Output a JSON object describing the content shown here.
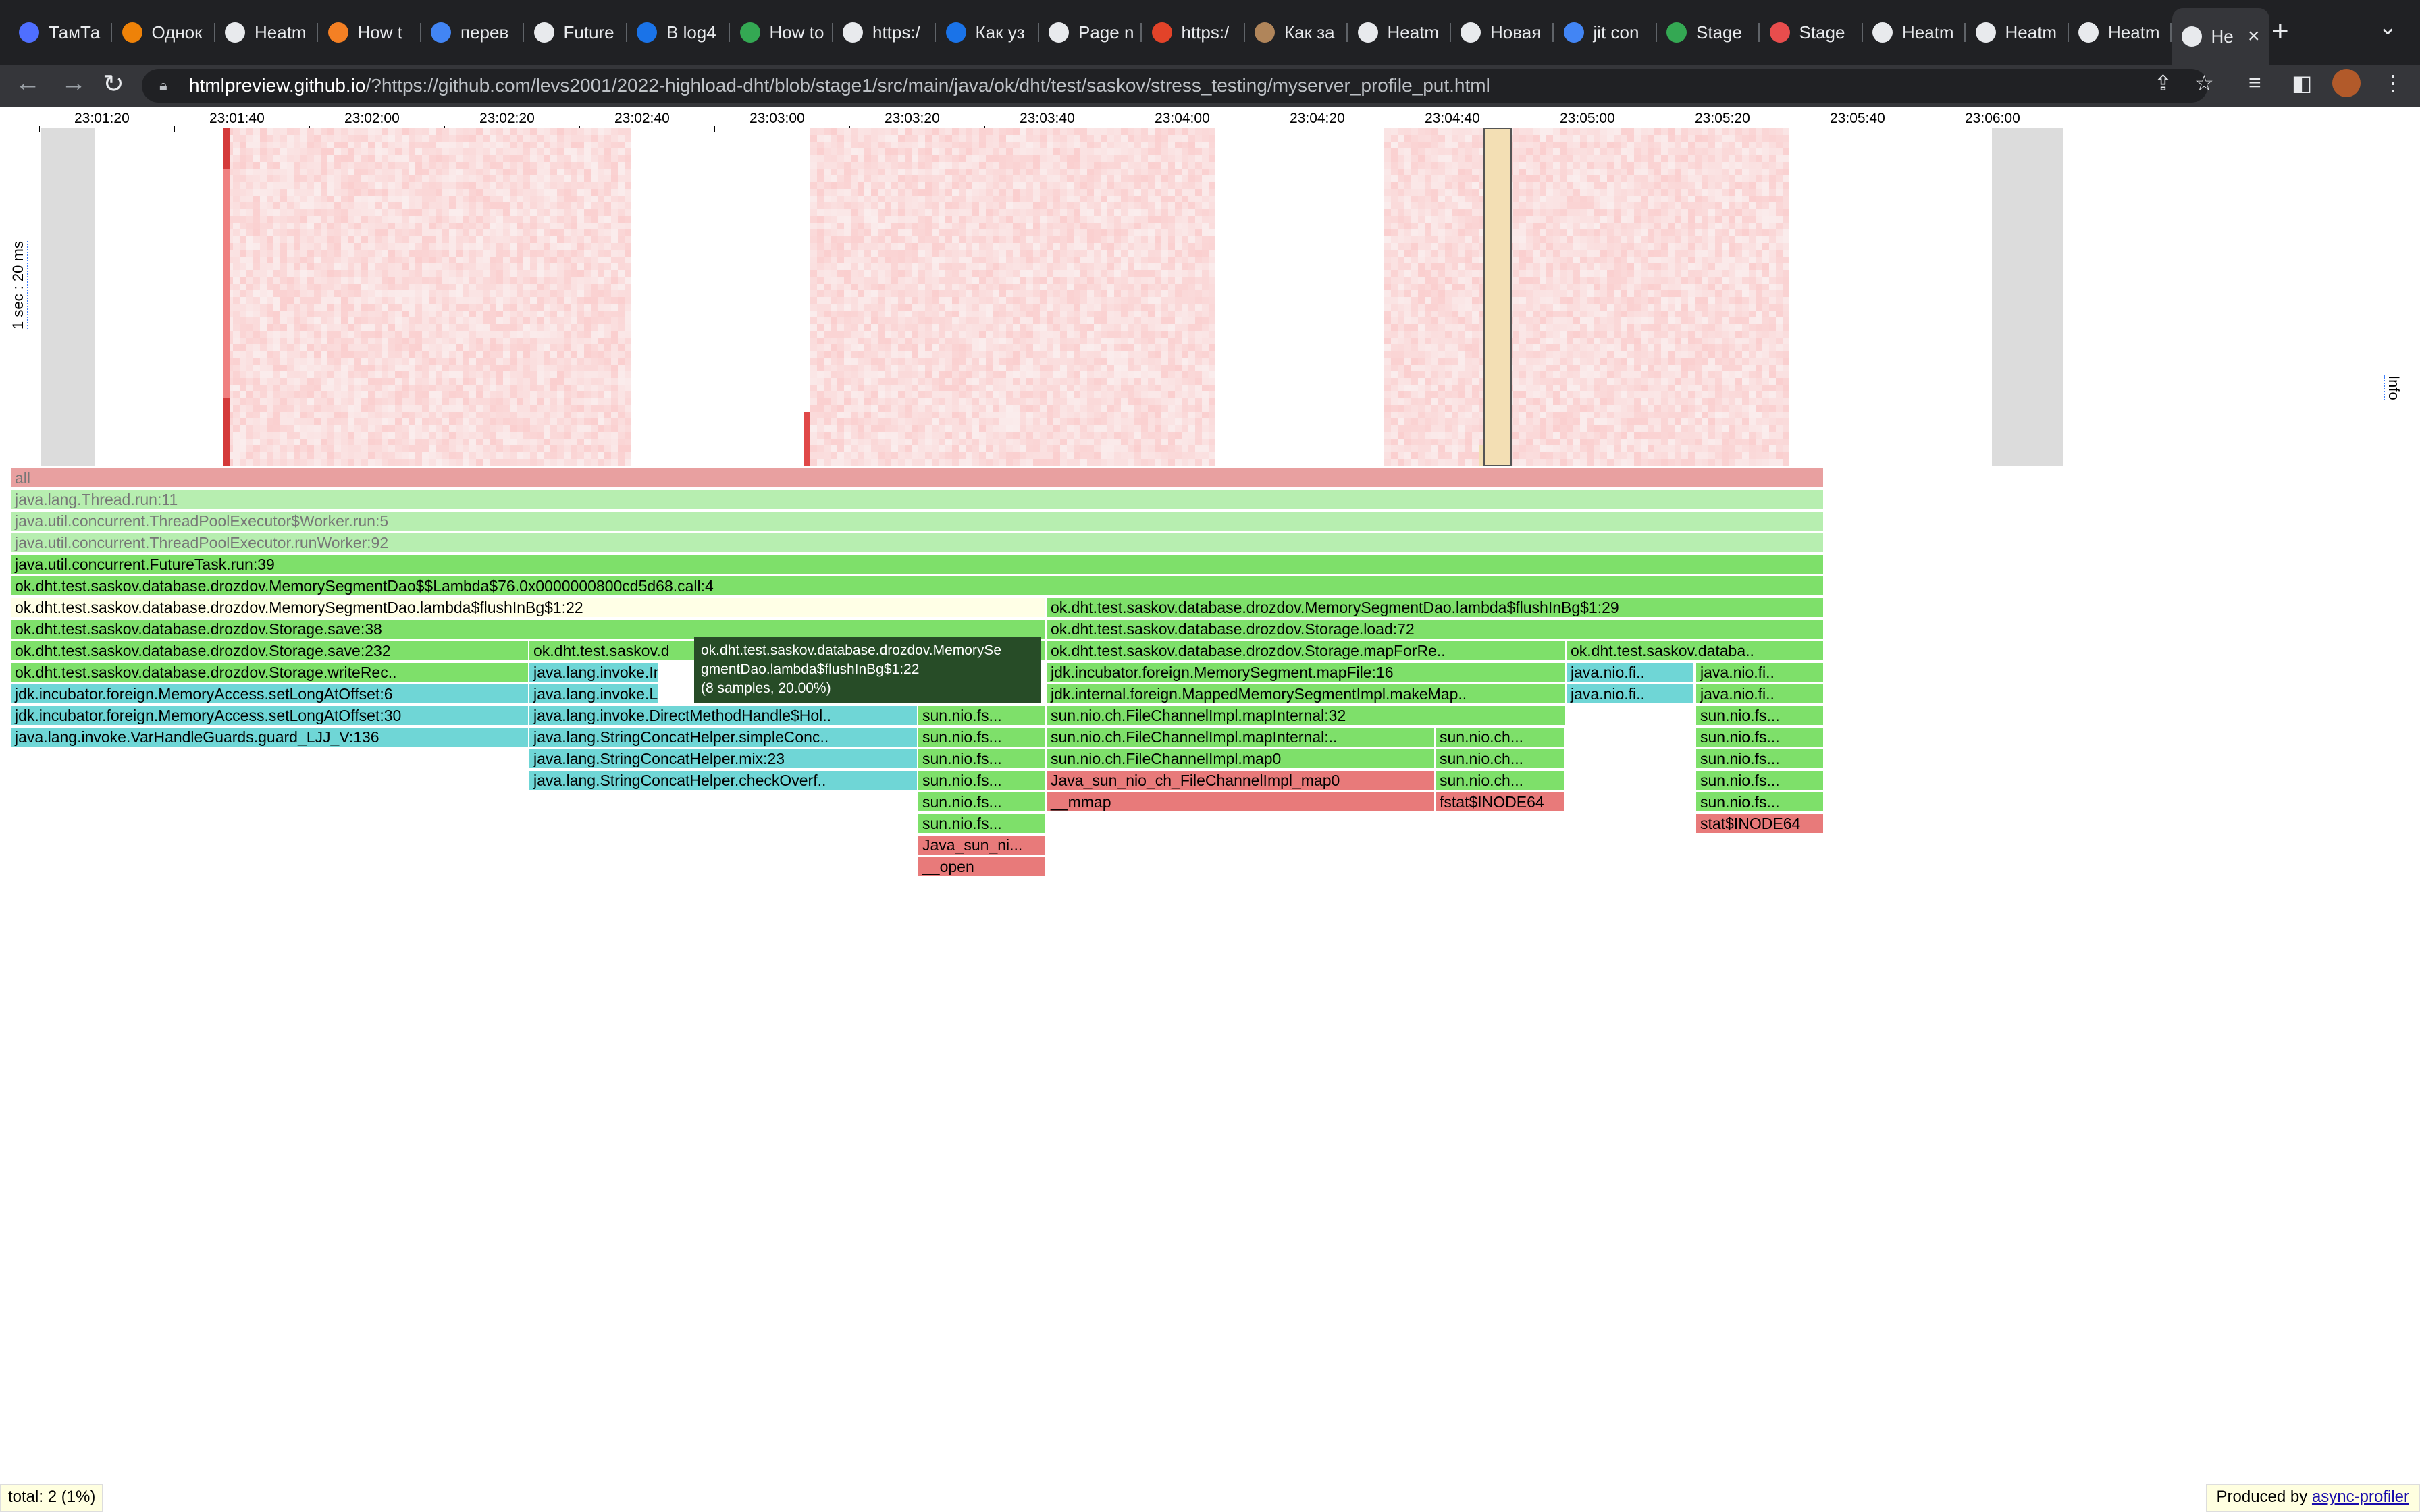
{
  "browser": {
    "tabs": [
      {
        "title": "ТамТа",
        "icon": "chat-bubble-icon",
        "color": "#4f6fff"
      },
      {
        "title": "Однок",
        "icon": "ok-logo-icon",
        "color": "#ee8208"
      },
      {
        "title": "Heatm",
        "icon": "globe-icon",
        "color": "#e8eaed"
      },
      {
        "title": "How t",
        "icon": "stackoverflow-icon",
        "color": "#f48024"
      },
      {
        "title": "перев",
        "icon": "google-icon",
        "color": "#4285f4"
      },
      {
        "title": "Future",
        "icon": "globe-icon",
        "color": "#e8eaed"
      },
      {
        "title": "В log4",
        "icon": "o-logo-icon",
        "color": "#1a73e8"
      },
      {
        "title": "How to",
        "icon": "glasses-icon",
        "color": "#34a853"
      },
      {
        "title": "https:/",
        "icon": "globe-icon",
        "color": "#e8eaed"
      },
      {
        "title": "Как уз",
        "icon": "o-logo-icon",
        "color": "#1a73e8"
      },
      {
        "title": "Page n",
        "icon": "globe-icon",
        "color": "#e8eaed"
      },
      {
        "title": "https:/",
        "icon": "shield-logo-icon",
        "color": "#e24329"
      },
      {
        "title": "Как за",
        "icon": "horse-icon",
        "color": "#b0855a"
      },
      {
        "title": "Heatm",
        "icon": "globe-icon",
        "color": "#e8eaed"
      },
      {
        "title": "Новая",
        "icon": "chrome-icon",
        "color": "#e8eaed"
      },
      {
        "title": "jit con",
        "icon": "google-icon",
        "color": "#4285f4"
      },
      {
        "title": "Stage",
        "icon": "spinner-icon",
        "color": "#34a853"
      },
      {
        "title": "Stage",
        "icon": "chart-logo-icon",
        "color": "#e84d4d"
      },
      {
        "title": "Heatm",
        "icon": "globe-icon",
        "color": "#e8eaed"
      },
      {
        "title": "Heatm",
        "icon": "globe-icon",
        "color": "#e8eaed"
      },
      {
        "title": "Heatm",
        "icon": "globe-icon",
        "color": "#e8eaed"
      },
      {
        "title": "He",
        "icon": "globe-icon",
        "color": "#e8eaed",
        "active": true
      }
    ],
    "url_host": "htmlpreview.github.io",
    "url_path": "/?https://github.com/levs2001/2022-highload-dht/blob/stage1/src/main/java/ok/dht/test/saskov/stress_testing/myserver_profile_put.html"
  },
  "timeline": {
    "labels": [
      "23:01:20",
      "23:01:40",
      "23:02:00",
      "23:02:20",
      "23:02:40",
      "23:03:00",
      "23:03:20",
      "23:03:40",
      "23:04:00",
      "23:04:20",
      "23:04:40",
      "23:05:00",
      "23:05:20",
      "23:05:40",
      "23:06:00"
    ],
    "scale_label": "1 sec : 20 ms",
    "info_label": "Info"
  },
  "flame": {
    "frames": [
      {
        "text": "all",
        "color": "#e8a0a0",
        "dim": true
      },
      {
        "text": "java.lang.Thread.run:11",
        "color": "#b7eeb0",
        "dim": true
      },
      {
        "text": "java.util.concurrent.ThreadPoolExecutor$Worker.run:5",
        "color": "#b7eeb0",
        "dim": true
      },
      {
        "text": "java.util.concurrent.ThreadPoolExecutor.runWorker:92",
        "color": "#b7eeb0",
        "dim": true
      },
      {
        "text": "java.util.concurrent.FutureTask.run:39",
        "color": "#7ee06a"
      },
      {
        "text": "ok.dht.test.saskov.database.drozdov.MemorySegmentDao$$Lambda$76.0x0000000800cd5d68.call:4",
        "color": "#7ee06a"
      },
      {
        "text": "ok.dht.test.saskov.database.drozdov.MemorySegmentDao.lambda$flushInBg$1:22",
        "color": "#ffffe6"
      },
      {
        "text": "ok.dht.test.saskov.database.drozdov.MemorySegmentDao.lambda$flushInBg$1:29",
        "color": "#7ee06a"
      },
      {
        "text": "ok.dht.test.saskov.database.drozdov.Storage.save:38",
        "color": "#7ee06a"
      },
      {
        "text": "ok.dht.test.saskov.database.drozdov.Storage.load:72",
        "color": "#7ee06a"
      },
      {
        "text": "ok.dht.test.saskov.database.drozdov.Storage.save:232",
        "color": "#7ee06a"
      },
      {
        "text": "ok.dht.test.saskov.d",
        "color": "#7ee06a"
      },
      {
        "text": "ok.dht.test.saskov.database.drozdov.Storage.mapForRe..",
        "color": "#7ee06a"
      },
      {
        "text": "ok.dht.test.saskov.databa..",
        "color": "#7ee06a"
      },
      {
        "text": "ok.dht.test.saskov.database.drozdov.Storage.writeRec..",
        "color": "#7ee06a"
      },
      {
        "text": "java.lang.invoke.Inv",
        "color": "#6fd6d6"
      },
      {
        "text": "jdk.incubator.foreign.MemorySegment.mapFile:16",
        "color": "#7ee06a"
      },
      {
        "text": "java.nio.fi..",
        "color": "#6fd6d6"
      },
      {
        "text": "java.nio.fi..",
        "color": "#7ee06a"
      },
      {
        "text": "jdk.incubator.foreign.MemoryAccess.setLongAtOffset:6",
        "color": "#6fd6d6"
      },
      {
        "text": "java.lang.invoke.La",
        "color": "#6fd6d6"
      },
      {
        "text": "jdk.internal.foreign.MappedMemorySegmentImpl.makeMap..",
        "color": "#7ee06a"
      },
      {
        "text": "java.nio.fi..",
        "color": "#6fd6d6"
      },
      {
        "text": "java.nio.fi..",
        "color": "#7ee06a"
      },
      {
        "text": "jdk.incubator.foreign.MemoryAccess.setLongAtOffset:30",
        "color": "#6fd6d6"
      },
      {
        "text": "java.lang.invoke.DirectMethodHandle$Hol..",
        "color": "#6fd6d6"
      },
      {
        "text": "sun.nio.fs...",
        "color": "#7ee06a"
      },
      {
        "text": "sun.nio.ch.FileChannelImpl.mapInternal:32",
        "color": "#7ee06a"
      },
      {
        "text": "sun.nio.fs...",
        "color": "#7ee06a"
      },
      {
        "text": "java.lang.invoke.VarHandleGuards.guard_LJJ_V:136",
        "color": "#6fd6d6"
      },
      {
        "text": "java.lang.StringConcatHelper.simpleConc..",
        "color": "#6fd6d6"
      },
      {
        "text": "sun.nio.fs...",
        "color": "#7ee06a"
      },
      {
        "text": "sun.nio.ch.FileChannelImpl.mapInternal:..",
        "color": "#7ee06a"
      },
      {
        "text": "sun.nio.ch...",
        "color": "#7ee06a"
      },
      {
        "text": "sun.nio.fs...",
        "color": "#7ee06a"
      },
      {
        "text": "java.lang.StringConcatHelper.mix:23",
        "color": "#6fd6d6"
      },
      {
        "text": "sun.nio.fs...",
        "color": "#7ee06a"
      },
      {
        "text": "sun.nio.ch.FileChannelImpl.map0",
        "color": "#7ee06a"
      },
      {
        "text": "sun.nio.ch...",
        "color": "#7ee06a"
      },
      {
        "text": "sun.nio.fs...",
        "color": "#7ee06a"
      },
      {
        "text": "java.lang.StringConcatHelper.checkOverf..",
        "color": "#6fd6d6"
      },
      {
        "text": "sun.nio.fs...",
        "color": "#7ee06a"
      },
      {
        "text": "Java_sun_nio_ch_FileChannelImpl_map0",
        "color": "#e87a7a"
      },
      {
        "text": "sun.nio.ch...",
        "color": "#7ee06a"
      },
      {
        "text": "sun.nio.fs...",
        "color": "#7ee06a"
      },
      {
        "text": "sun.nio.fs...",
        "color": "#7ee06a"
      },
      {
        "text": "__mmap",
        "color": "#e87a7a"
      },
      {
        "text": "fstat$INODE64",
        "color": "#e87a7a"
      },
      {
        "text": "sun.nio.fs...",
        "color": "#7ee06a"
      },
      {
        "text": "sun.nio.fs...",
        "color": "#7ee06a"
      },
      {
        "text": "stat$INODE64",
        "color": "#e87a7a"
      },
      {
        "text": "Java_sun_ni...",
        "color": "#e87a7a"
      },
      {
        "text": "__open",
        "color": "#e87a7a"
      }
    ]
  },
  "tooltip": {
    "line1": "ok.dht.test.saskov.database.drozdov.MemorySe",
    "line2": "gmentDao.lambda$flushInBg$1:22",
    "line3": "(8 samples, 20.00%)"
  },
  "status": {
    "total": "total: 2 (1%)",
    "produced_prefix": "Produced by",
    "produced_link": "async-profiler"
  }
}
